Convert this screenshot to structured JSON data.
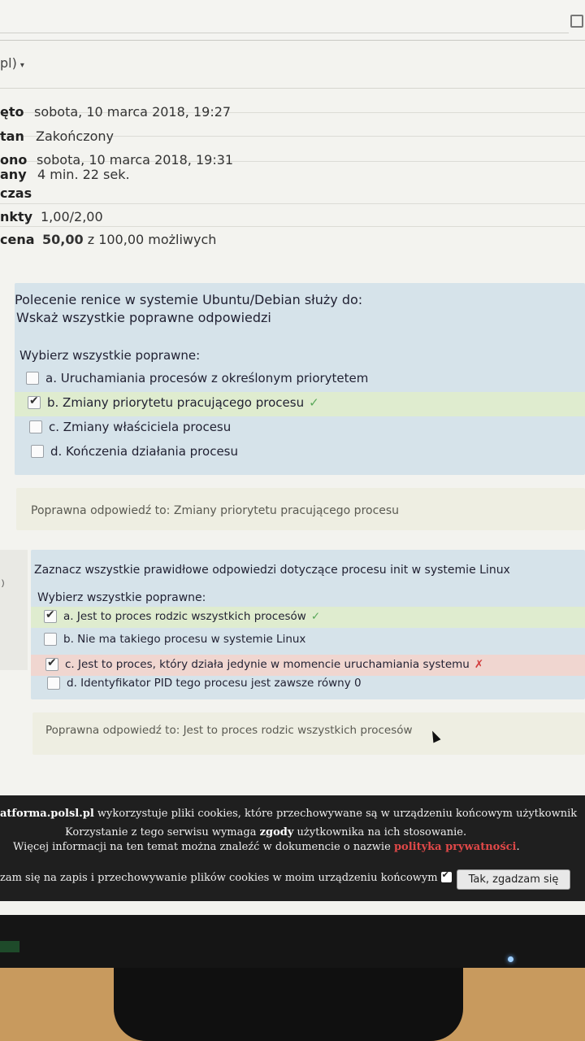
{
  "header": {
    "lang_label": "pl)",
    "lang_caret": "▾"
  },
  "summary": [
    {
      "label": "ęto",
      "value": "sobota, 10 marca 2018, 19:27"
    },
    {
      "label": "tan",
      "value": "Zakończony"
    },
    {
      "label": "ono",
      "value": "sobota, 10 marca 2018, 19:31"
    },
    {
      "label": "any",
      "label2": "czas",
      "value": "4 min. 22 sek."
    },
    {
      "label": "nkty",
      "value": "1,00/2,00"
    },
    {
      "label": "cena",
      "value_bold": "50,00",
      "value": "z 100,00 możliwych"
    }
  ],
  "q1": {
    "text": "Polecenie renice w systemie Ubuntu/Debian służy do:",
    "text2": "Wskaż wszystkie poprawne odpowiedzi",
    "prompt": "Wybierz wszystkie poprawne:",
    "options": [
      {
        "label": "a. Uruchamiania procesów z określonym priorytetem",
        "checked": false,
        "mark": ""
      },
      {
        "label": "b. Zmiany priorytetu pracującego procesu",
        "checked": true,
        "mark": "✓"
      },
      {
        "label": "c. Zmiany właściciela procesu",
        "checked": false,
        "mark": ""
      },
      {
        "label": "d. Kończenia działania procesu",
        "checked": false,
        "mark": ""
      }
    ],
    "feedback": "Poprawna odpowiedź to: Zmiany priorytetu pracującego procesu"
  },
  "q2": {
    "side": ")",
    "text": "Zaznacz wszystkie prawidłowe odpowiedzi dotyczące procesu init w systemie Linux",
    "prompt": "Wybierz wszystkie poprawne:",
    "options": [
      {
        "label": "a. Jest to proces rodzic wszystkich procesów",
        "checked": true,
        "mark": "✓"
      },
      {
        "label": "b. Nie ma takiego procesu w systemie Linux",
        "checked": false,
        "mark": ""
      },
      {
        "label": "c. Jest to proces, który działa jedynie w momencie uruchamiania systemu",
        "checked": true,
        "mark": "✗"
      },
      {
        "label": "d. Identyfikator PID tego procesu jest zawsze równy 0",
        "checked": false,
        "mark": ""
      }
    ],
    "feedback": "Poprawna odpowiedź to: Jest to proces rodzic wszystkich procesów"
  },
  "cookie": {
    "line1_bold": "atforma.polsl.pl",
    "line1": "wykorzystuje pliki cookies, które przechowywane są w urządzeniu końcowym użytkownik",
    "line2a": "Korzystanie z tego serwisu wymaga",
    "line2_bold": "zgody",
    "line2b": "użytkownika na ich stosowanie.",
    "line3a": "Więcej informacji na ten temat można znaleźć w dokumencie o nazwie",
    "line3_link": "polityka prywatności",
    "line3b": ".",
    "consent": "zam się na zapis i przechowywanie plików cookies w moim urządzeniu końcowym",
    "accept_button": "Tak, zgadzam się"
  },
  "colors": {
    "correct": "#5aa85a",
    "wrong": "#d23b3b",
    "card": "#d6e3ea"
  }
}
